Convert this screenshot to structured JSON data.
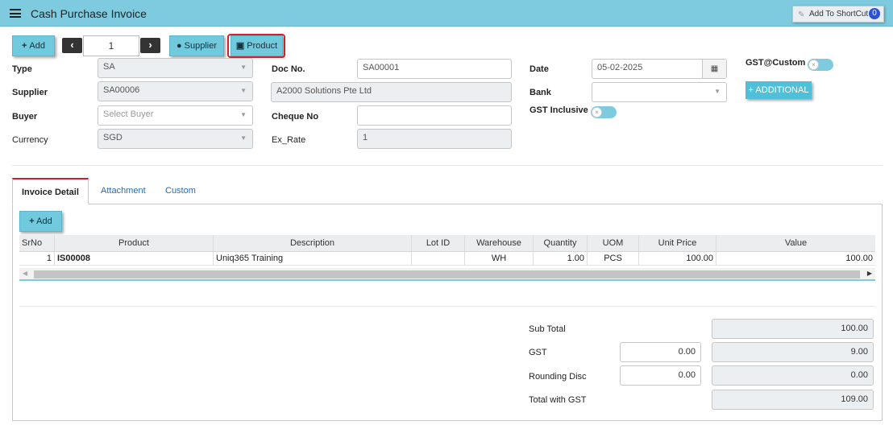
{
  "header": {
    "title": "Cash Purchase Invoice",
    "shortcut_label": "Add To ShortCut",
    "shortcut_count": "0"
  },
  "toolbar": {
    "add_label": "Add",
    "record_number": "1",
    "supplier_label": "Supplier",
    "product_label": "Product"
  },
  "form": {
    "type": {
      "label": "Type",
      "value": "SA"
    },
    "supplier": {
      "label": "Supplier",
      "value": "SA00006"
    },
    "buyer": {
      "label": "Buyer",
      "placeholder": "Select Buyer"
    },
    "currency": {
      "label": "Currency",
      "value": "SGD"
    },
    "doc_no": {
      "label": "Doc No.",
      "value": "SA00001"
    },
    "supplier_name": {
      "value": "A2000 Solutions Pte Ltd"
    },
    "cheque_no": {
      "label": "Cheque No",
      "value": ""
    },
    "ex_rate": {
      "label": "Ex_Rate",
      "value": "1"
    },
    "date": {
      "label": "Date",
      "value": "05-02-2025"
    },
    "bank": {
      "label": "Bank",
      "value": ""
    },
    "gst_inclusive": {
      "label": "GST Inclusive",
      "on": false
    },
    "gst_custom": {
      "label": "GST@Custom",
      "on": false
    },
    "additional_label": "ADDITIONAL"
  },
  "tabs": [
    {
      "label": "Invoice Detail",
      "active": true
    },
    {
      "label": "Attachment",
      "active": false
    },
    {
      "label": "Custom",
      "active": false
    }
  ],
  "grid": {
    "add_label": "Add",
    "columns": [
      "SrNo",
      "Product",
      "Description",
      "Lot ID",
      "Warehouse",
      "Quantity",
      "UOM",
      "Unit Price",
      "Value"
    ],
    "rows": [
      {
        "srno": "1",
        "product": "IS00008",
        "description": "Uniq365 Training",
        "lot_id": "",
        "warehouse": "WH",
        "quantity": "1.00",
        "uom": "PCS",
        "unit_price": "100.00",
        "value": "100.00"
      }
    ]
  },
  "totals": {
    "sub_total": {
      "label": "Sub Total",
      "value": "100.00"
    },
    "gst": {
      "label": "GST",
      "rate": "0.00",
      "value": "9.00"
    },
    "rounding": {
      "label": "Rounding Disc",
      "rate": "0.00",
      "value": "0.00"
    },
    "total_with_gst": {
      "label": "Total with GST",
      "value": "109.00"
    }
  },
  "colors": {
    "accent": "#7ecbe0",
    "button": "#71c9dd",
    "highlight": "#d0202a",
    "link": "#2a6aa8"
  },
  "icons": [
    "menu-icon",
    "pin-icon",
    "plus-icon",
    "chevron-left-icon",
    "chevron-right-icon",
    "user-icon",
    "gift-icon",
    "calendar-icon",
    "dropdown-caret-icon"
  ]
}
